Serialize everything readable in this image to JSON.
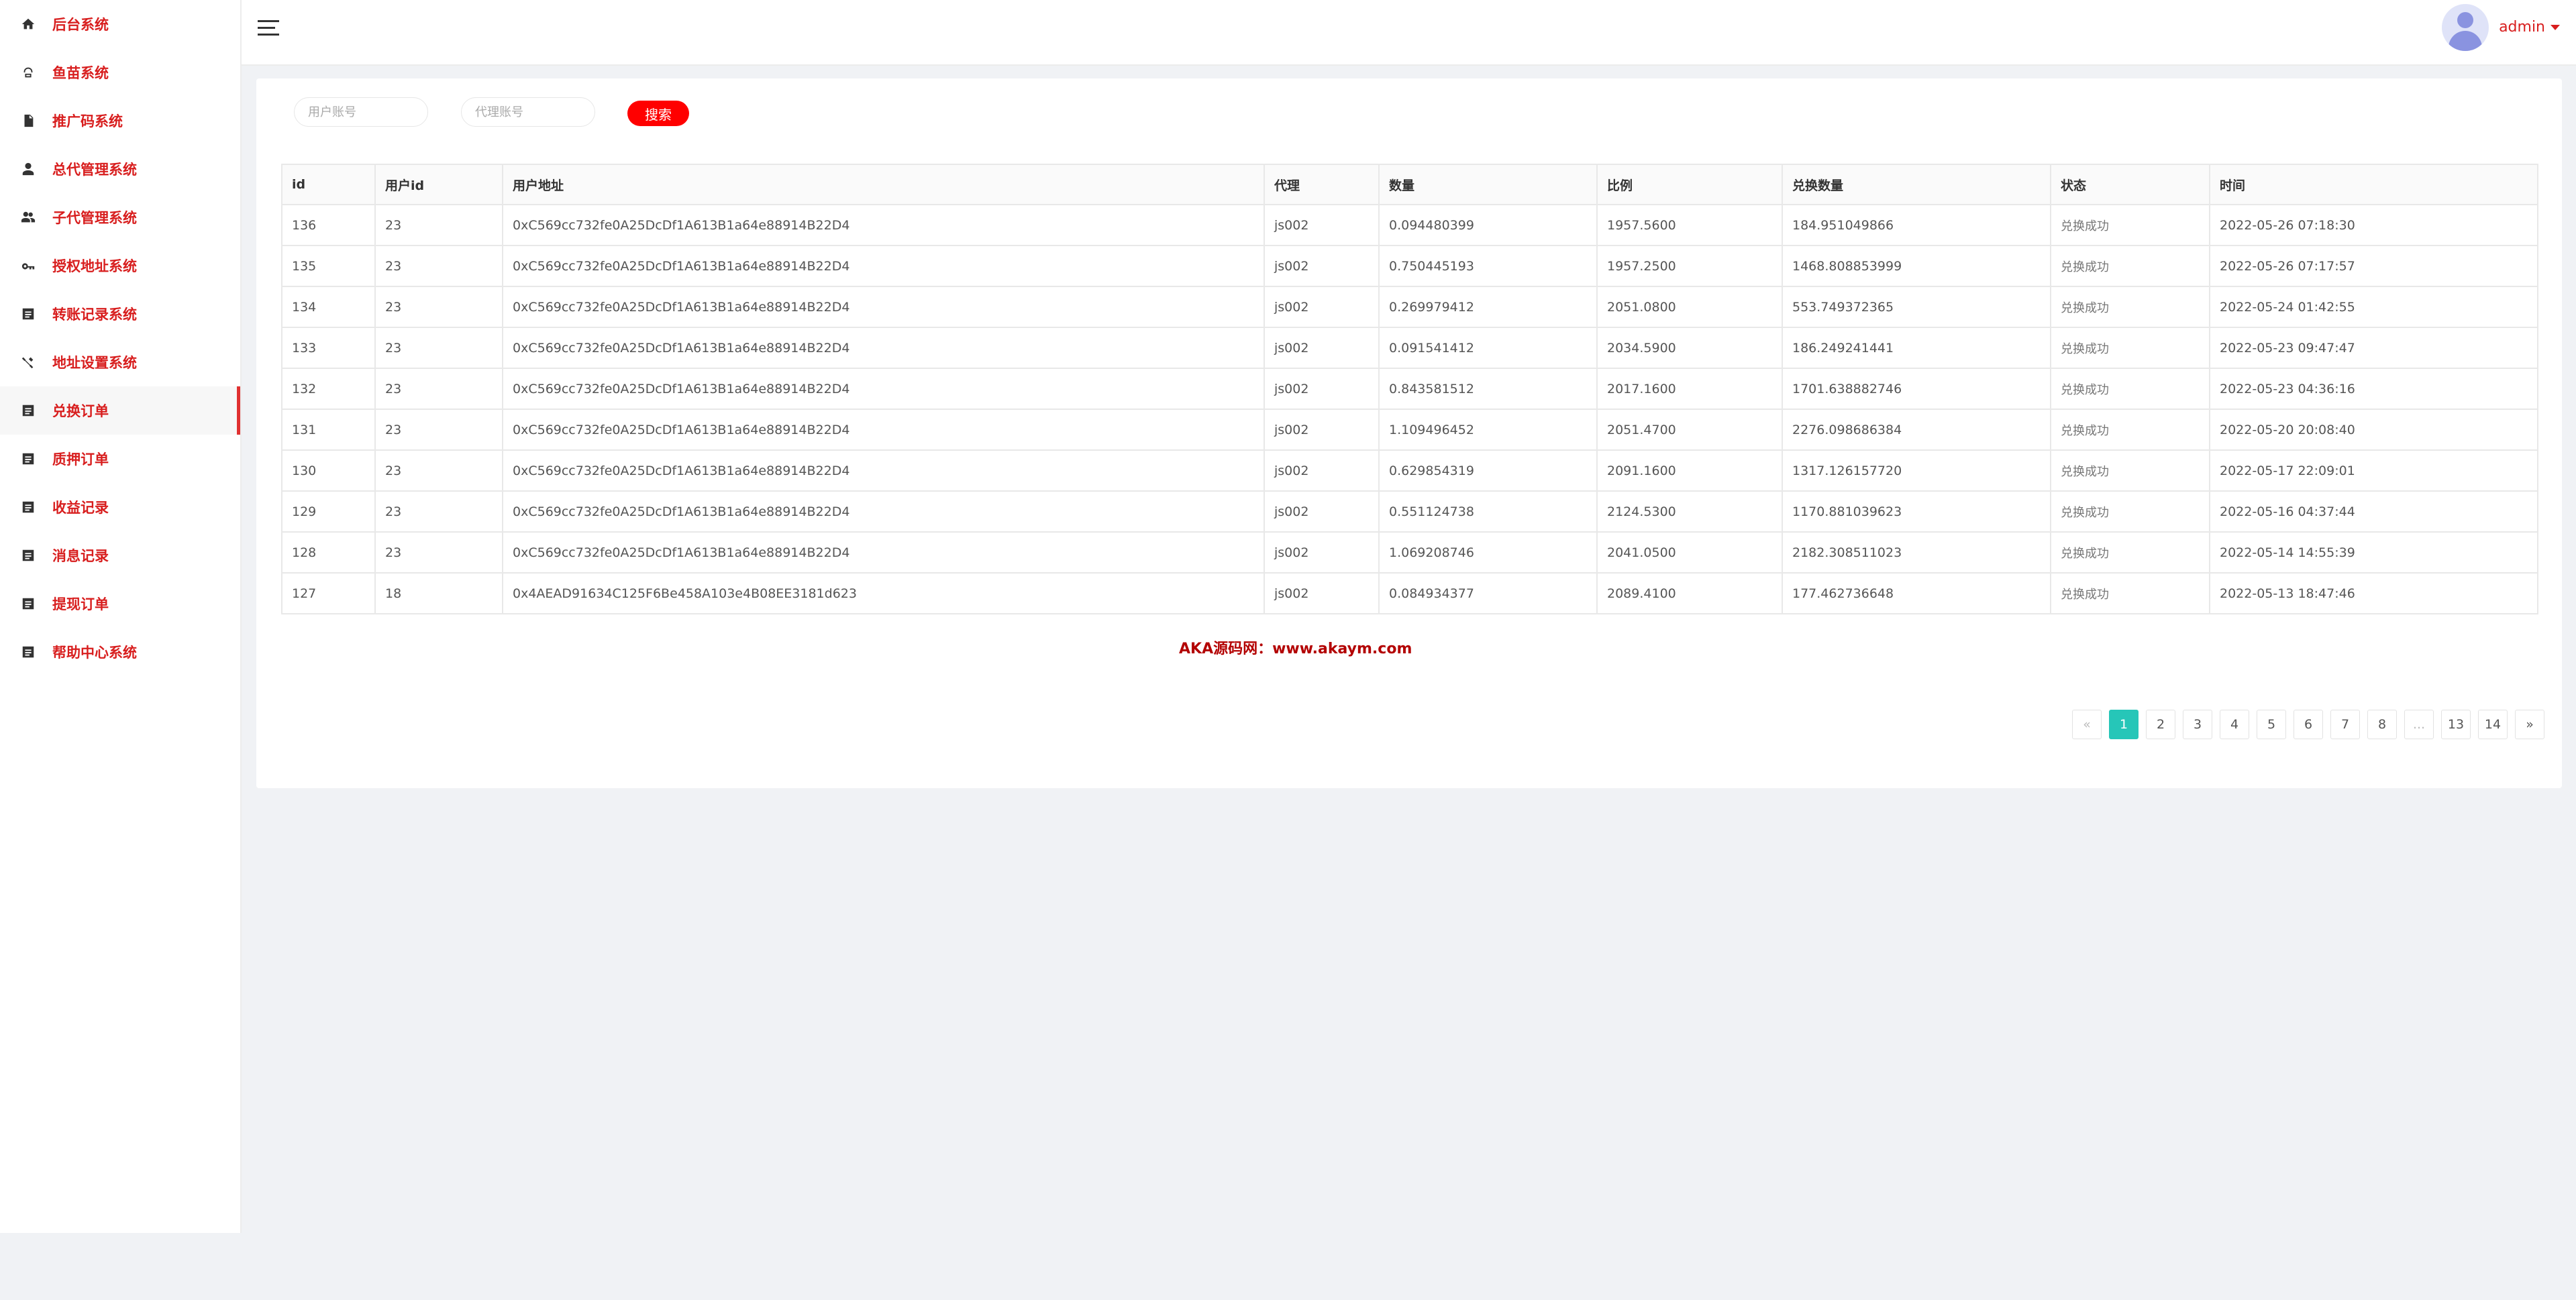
{
  "sidebar": {
    "items": [
      {
        "label": "后台系统",
        "icon": "home-icon"
      },
      {
        "label": "鱼苗系统",
        "icon": "fish-icon"
      },
      {
        "label": "推广码系统",
        "icon": "document-icon"
      },
      {
        "label": "总代管理系统",
        "icon": "person-icon"
      },
      {
        "label": "子代管理系统",
        "icon": "people-icon"
      },
      {
        "label": "授权地址系统",
        "icon": "key-icon"
      },
      {
        "label": "转账记录系统",
        "icon": "list-icon"
      },
      {
        "label": "地址设置系统",
        "icon": "settings-tool-icon"
      },
      {
        "label": "兑换订单",
        "icon": "list-icon",
        "active": true
      },
      {
        "label": "质押订单",
        "icon": "list-icon"
      },
      {
        "label": "收益记录",
        "icon": "list-icon"
      },
      {
        "label": "消息记录",
        "icon": "list-icon"
      },
      {
        "label": "提现订单",
        "icon": "list-icon"
      },
      {
        "label": "帮助中心系统",
        "icon": "list-icon"
      }
    ]
  },
  "header": {
    "username": "admin"
  },
  "search": {
    "user_placeholder": "用户账号",
    "agent_placeholder": "代理账号",
    "button_label": "搜索"
  },
  "table": {
    "headers": [
      "id",
      "用户id",
      "用户地址",
      "代理",
      "数量",
      "比例",
      "兑换数量",
      "状态",
      "时间"
    ],
    "rows": [
      [
        "136",
        "23",
        "0xC569cc732fe0A25DcDf1A613B1a64e88914B22D4",
        "js002",
        "0.094480399",
        "1957.5600",
        "184.951049866",
        "兑换成功",
        "2022-05-26 07:18:30"
      ],
      [
        "135",
        "23",
        "0xC569cc732fe0A25DcDf1A613B1a64e88914B22D4",
        "js002",
        "0.750445193",
        "1957.2500",
        "1468.808853999",
        "兑换成功",
        "2022-05-26 07:17:57"
      ],
      [
        "134",
        "23",
        "0xC569cc732fe0A25DcDf1A613B1a64e88914B22D4",
        "js002",
        "0.269979412",
        "2051.0800",
        "553.749372365",
        "兑换成功",
        "2022-05-24 01:42:55"
      ],
      [
        "133",
        "23",
        "0xC569cc732fe0A25DcDf1A613B1a64e88914B22D4",
        "js002",
        "0.091541412",
        "2034.5900",
        "186.249241441",
        "兑换成功",
        "2022-05-23 09:47:47"
      ],
      [
        "132",
        "23",
        "0xC569cc732fe0A25DcDf1A613B1a64e88914B22D4",
        "js002",
        "0.843581512",
        "2017.1600",
        "1701.638882746",
        "兑换成功",
        "2022-05-23 04:36:16"
      ],
      [
        "131",
        "23",
        "0xC569cc732fe0A25DcDf1A613B1a64e88914B22D4",
        "js002",
        "1.109496452",
        "2051.4700",
        "2276.098686384",
        "兑换成功",
        "2022-05-20 20:08:40"
      ],
      [
        "130",
        "23",
        "0xC569cc732fe0A25DcDf1A613B1a64e88914B22D4",
        "js002",
        "0.629854319",
        "2091.1600",
        "1317.126157720",
        "兑换成功",
        "2022-05-17 22:09:01"
      ],
      [
        "129",
        "23",
        "0xC569cc732fe0A25DcDf1A613B1a64e88914B22D4",
        "js002",
        "0.551124738",
        "2124.5300",
        "1170.881039623",
        "兑换成功",
        "2022-05-16 04:37:44"
      ],
      [
        "128",
        "23",
        "0xC569cc732fe0A25DcDf1A613B1a64e88914B22D4",
        "js002",
        "1.069208746",
        "2041.0500",
        "2182.308511023",
        "兑换成功",
        "2022-05-14 14:55:39"
      ],
      [
        "127",
        "18",
        "0x4AEAD91634C125F6Be458A103e4B08EE3181d623",
        "js002",
        "0.084934377",
        "2089.4100",
        "177.462736648",
        "兑换成功",
        "2022-05-13 18:47:46"
      ]
    ]
  },
  "watermark": "AKA源码网：www.akaym.com",
  "pagination": {
    "prev": "«",
    "next": "»",
    "pages": [
      "1",
      "2",
      "3",
      "4",
      "5",
      "6",
      "7",
      "8",
      "...",
      "13",
      "14"
    ],
    "current": "1"
  },
  "colors": {
    "accent": "#d81e1e",
    "button": "#ff0000",
    "page_active": "#26c6b8"
  }
}
